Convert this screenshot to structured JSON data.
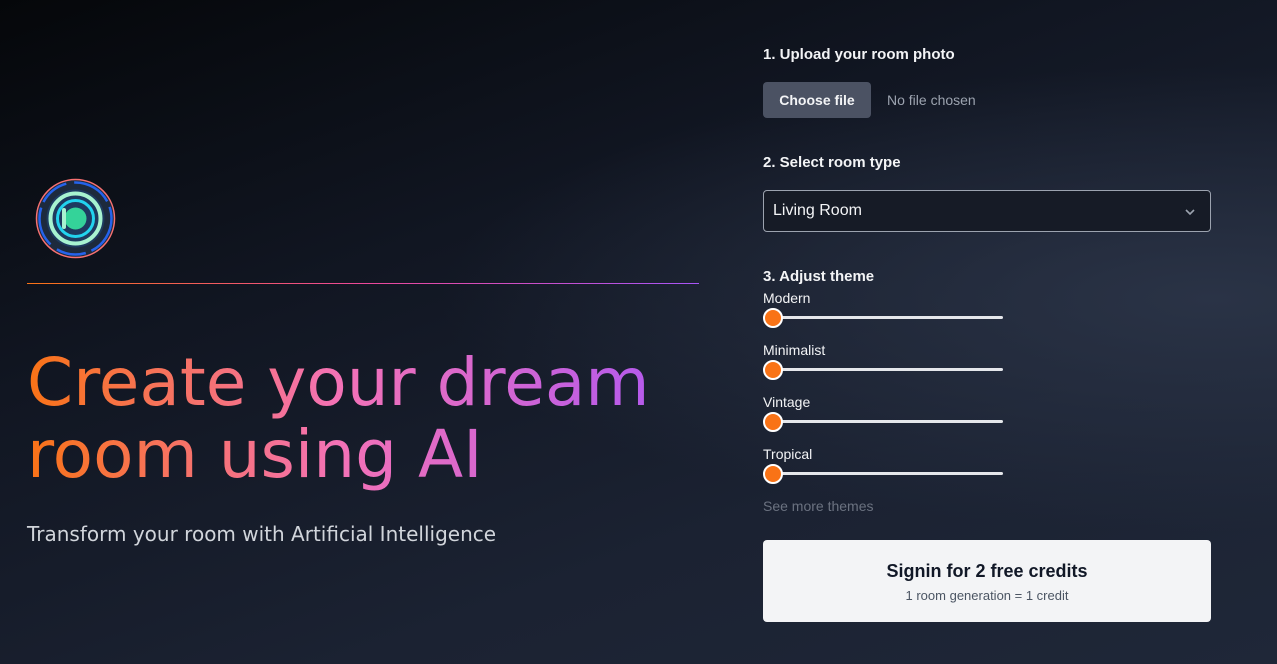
{
  "hero": {
    "headline": "Create your dream room using AI",
    "subheadline": "Transform your room with Artificial Intelligence",
    "logo_icon": "circular-logo-icon"
  },
  "form": {
    "upload": {
      "title": "1. Upload your room photo",
      "button_label": "Choose file",
      "status": "No file chosen"
    },
    "room_type": {
      "title": "2. Select room type",
      "selected": "Living Room",
      "icon": "chevron-down-icon"
    },
    "theme": {
      "title": "3. Adjust theme",
      "sliders": [
        {
          "label": "Modern",
          "value": 0
        },
        {
          "label": "Minimalist",
          "value": 0
        },
        {
          "label": "Vintage",
          "value": 0
        },
        {
          "label": "Tropical",
          "value": 0
        }
      ],
      "more_link": "See more themes"
    },
    "signin": {
      "label": "Signin for 2 free credits",
      "sublabel": "1 room generation = 1 credit"
    }
  },
  "colors": {
    "accent": "#f97316",
    "gradient_start": "#f97316",
    "gradient_mid": "#ec4899",
    "gradient_end": "#a855f7"
  }
}
